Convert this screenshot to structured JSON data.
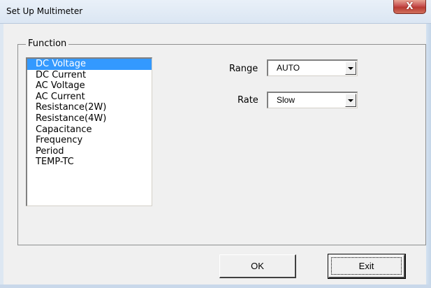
{
  "window": {
    "title": "Set Up Multimeter",
    "close_label": "X"
  },
  "function_group": {
    "label": "Function",
    "items": [
      {
        "label": "DC Voltage",
        "selected": true
      },
      {
        "label": "DC Current",
        "selected": false
      },
      {
        "label": "AC Voltage",
        "selected": false
      },
      {
        "label": "AC Current",
        "selected": false
      },
      {
        "label": "Resistance(2W)",
        "selected": false
      },
      {
        "label": "Resistance(4W)",
        "selected": false
      },
      {
        "label": "Capacitance",
        "selected": false
      },
      {
        "label": "Frequency",
        "selected": false
      },
      {
        "label": "Period",
        "selected": false
      },
      {
        "label": "TEMP-TC",
        "selected": false
      }
    ]
  },
  "range": {
    "label": "Range",
    "value": "AUTO"
  },
  "rate": {
    "label": "Rate",
    "value": "Slow"
  },
  "buttons": {
    "ok_label": "OK",
    "exit_label": "Exit"
  },
  "colors": {
    "selection": "#3399ff",
    "close_button": "#c75050",
    "dialog_background": "#f0f0f0"
  }
}
